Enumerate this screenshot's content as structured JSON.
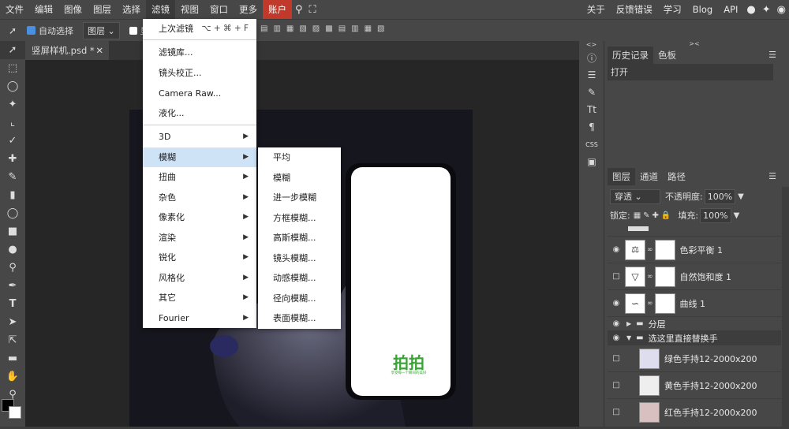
{
  "menubar": {
    "items": [
      "文件",
      "编辑",
      "图像",
      "图层",
      "选择",
      "滤镜",
      "视图",
      "窗口",
      "更多"
    ],
    "account": "账户",
    "right": [
      "关于",
      "反馈错误",
      "学习",
      "Blog",
      "API"
    ]
  },
  "options": {
    "auto_select": "自动选择",
    "layer_select": "图层",
    "show_label": "显"
  },
  "document": {
    "tab": "竖屏样机.psd *"
  },
  "filter_menu": {
    "items": [
      {
        "label": "上次滤镜",
        "shortcut": "⌥ + ⌘ + F"
      },
      {
        "label": "滤镜库..."
      },
      {
        "label": "镜头校正..."
      },
      {
        "label": "Camera Raw..."
      },
      {
        "label": "液化..."
      },
      {
        "label": "3D"
      },
      {
        "label": "模糊"
      },
      {
        "label": "扭曲"
      },
      {
        "label": "杂色"
      },
      {
        "label": "像素化"
      },
      {
        "label": "渲染"
      },
      {
        "label": "锐化"
      },
      {
        "label": "风格化"
      },
      {
        "label": "其它"
      },
      {
        "label": "Fourier"
      }
    ]
  },
  "blur_menu": {
    "items": [
      "平均",
      "模糊",
      "进一步模糊",
      "方框模糊...",
      "高斯模糊...",
      "镜头模糊...",
      "动感模糊...",
      "径向模糊...",
      "表面模糊..."
    ]
  },
  "history": {
    "tabs": [
      "历史记录",
      "色板"
    ],
    "items": [
      "打开"
    ]
  },
  "layers": {
    "tabs": [
      "图层",
      "通道",
      "路径"
    ],
    "blend": "穿透",
    "opacity_label": "不透明度:",
    "opacity": "100%",
    "lock_label": "锁定:",
    "fill_label": "填充:",
    "fill": "100%",
    "items": [
      "色彩平衡 1",
      "自然饱和度 1",
      "曲线 1",
      "分层",
      "选这里直接替换手",
      "绿色手持12-2000x200",
      "黄色手持12-2000x200",
      "红色手持12-2000x200"
    ]
  },
  "phone": {
    "logo": "拍拍",
    "tagline": "享受每一个瞬间的美好"
  }
}
